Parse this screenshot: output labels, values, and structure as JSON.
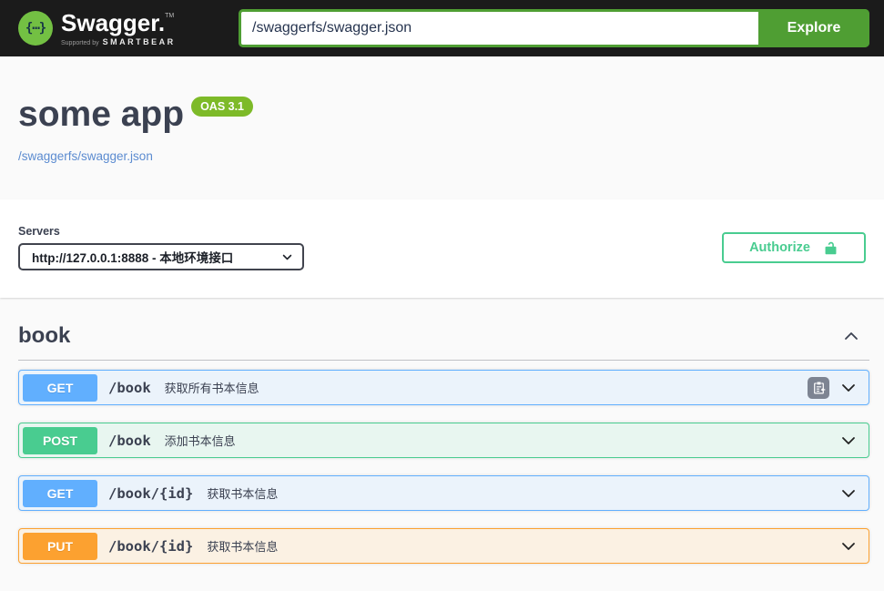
{
  "topbar": {
    "logo_glyph": "{⋯}",
    "brand": "Swagger.",
    "brand_tm": "TM",
    "supported_by": "Supported by",
    "smartbear": "SMARTBEAR",
    "url_value": "/swaggerfs/swagger.json",
    "explore_label": "Explore"
  },
  "info": {
    "title": "some app",
    "version_badge": "OAS 3.1",
    "spec_link": "/swaggerfs/swagger.json"
  },
  "servers": {
    "label": "Servers",
    "selected_option": "http://127.0.0.1:8888 - 本地环境接口"
  },
  "auth": {
    "authorize_label": "Authorize"
  },
  "tag_section": {
    "name": "book",
    "expanded": true
  },
  "operations": [
    {
      "method": "GET",
      "path": "/book",
      "summary": "获取所有书本信息",
      "has_clipboard": true
    },
    {
      "method": "POST",
      "path": "/book",
      "summary": "添加书本信息",
      "has_clipboard": false
    },
    {
      "method": "GET",
      "path": "/book/{id}",
      "summary": "获取书本信息",
      "has_clipboard": false
    },
    {
      "method": "PUT",
      "path": "/book/{id}",
      "summary": "获取书本信息",
      "has_clipboard": false
    }
  ],
  "colors": {
    "topbar_bg": "#1b1b1b",
    "brand_green": "#4f9e33",
    "logo_green": "#73c043",
    "badge_green": "#7dba28",
    "authorize_green": "#49cc90",
    "get_blue": "#61affe",
    "post_green": "#49cc90",
    "put_orange": "#fca130",
    "link_blue": "#5b8bd0",
    "text_dark": "#3b4151"
  }
}
